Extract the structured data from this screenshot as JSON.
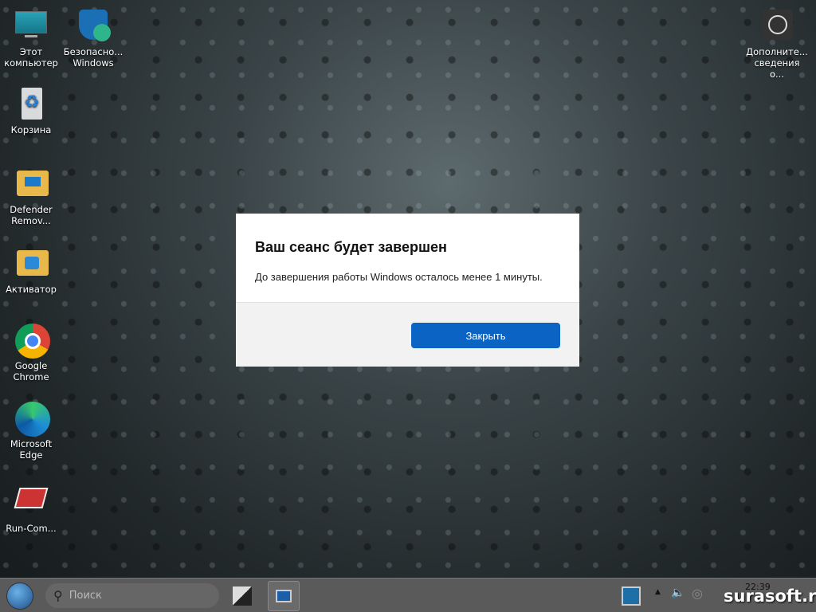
{
  "desktop_icons": [
    {
      "label": "Этот компьютер",
      "icon": "monitor-icon"
    },
    {
      "label": "Безопасно... Windows",
      "icon": "shield-icon"
    },
    {
      "label": "Корзина",
      "icon": "recycle-bin-icon"
    },
    {
      "label": "Defender Remov...",
      "icon": "folder-icon"
    },
    {
      "label": "Активатор",
      "icon": "folder-icon"
    },
    {
      "label": "Google Chrome",
      "icon": "chrome-icon"
    },
    {
      "label": "Microsoft Edge",
      "icon": "edge-icon"
    },
    {
      "label": "Run-Com...",
      "icon": "run-command-icon"
    },
    {
      "label": "Дополните... сведения о...",
      "icon": "user-circle-icon"
    }
  ],
  "dialog": {
    "title": "Ваш сеанс будет завершен",
    "message": "До завершения работы Windows осталось менее 1 минуты.",
    "close_label": "Закрыть",
    "accent": "#0b63c4"
  },
  "taskbar": {
    "search_placeholder": "Поиск",
    "time": "22:39"
  },
  "watermark": "surasoft.ru"
}
